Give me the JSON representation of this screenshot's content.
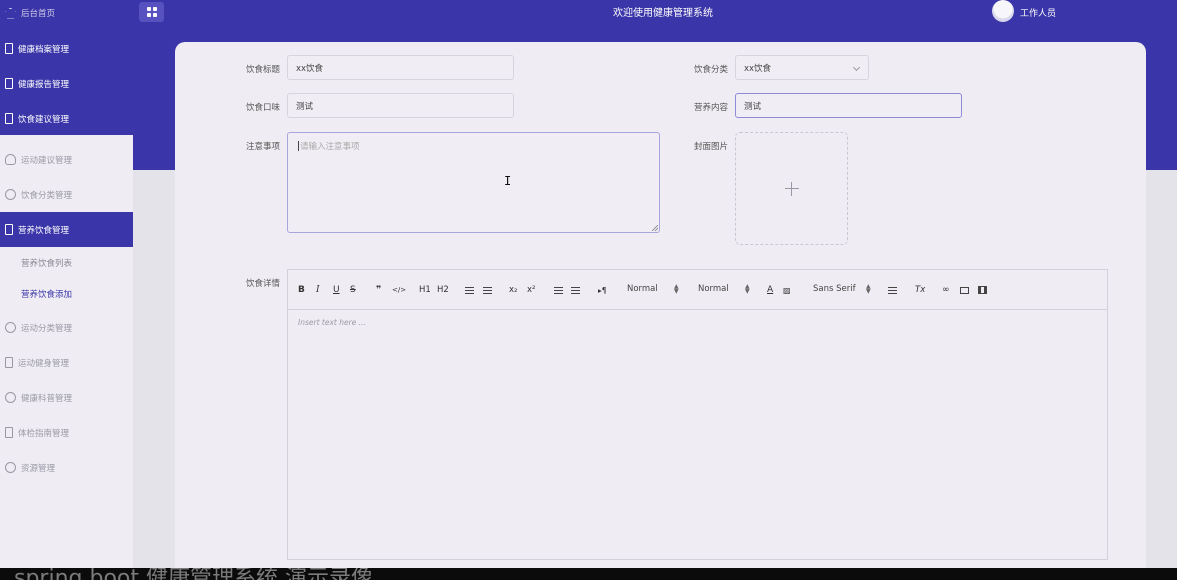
{
  "header": {
    "title": "欢迎使用健康管理系统",
    "user_name": "工作人员",
    "brand_color": "#3a35a8"
  },
  "sidebar": {
    "items": [
      {
        "label": "后台首页",
        "icon": "home-icon"
      },
      {
        "label": "健康档案管理",
        "icon": "document-icon"
      },
      {
        "label": "健康报告管理",
        "icon": "document-icon"
      },
      {
        "label": "饮食建议管理",
        "icon": "document-icon"
      },
      {
        "label": "运动建议管理",
        "icon": "user-icon"
      },
      {
        "label": "饮食分类管理",
        "icon": "chat-icon"
      },
      {
        "label": "营养饮食管理",
        "icon": "document-icon"
      },
      {
        "label": "运动分类管理",
        "icon": "chat-icon"
      },
      {
        "label": "运动健身管理",
        "icon": "document-icon"
      },
      {
        "label": "健康科普管理",
        "icon": "chat-icon"
      },
      {
        "label": "体检指南管理",
        "icon": "document-icon"
      },
      {
        "label": "资源管理",
        "icon": "chat-icon"
      }
    ],
    "sub_items": [
      {
        "label": "营养饮食列表"
      },
      {
        "label": "营养饮食添加"
      }
    ]
  },
  "form": {
    "title_label": "饮食标题",
    "title_value": "xx饮食",
    "category_label": "饮食分类",
    "category_value": "xx饮食",
    "taste_label": "饮食口味",
    "taste_value": "测试",
    "nutrition_label": "营养内容",
    "nutrition_value": "测试",
    "notes_label": "注意事项",
    "notes_placeholder": "请输入注意事项",
    "cover_label": "封面图片",
    "detail_label": "饮食详情"
  },
  "editor": {
    "placeholder": "Insert text here ...",
    "header_picker": "Normal",
    "size_picker": "Normal",
    "font_picker": "Sans Serif",
    "buttons": {
      "bold": "B",
      "italic": "I",
      "underline": "U",
      "strike": "S",
      "quote": "❞",
      "code": "</>",
      "h1": "H1",
      "h2": "H2",
      "sub": "x₂",
      "sup": "x²",
      "direction": "▸¶",
      "color": "A",
      "clean": "Tx"
    }
  },
  "overlay_text": "spring boot 健康管理系统 演示录像"
}
